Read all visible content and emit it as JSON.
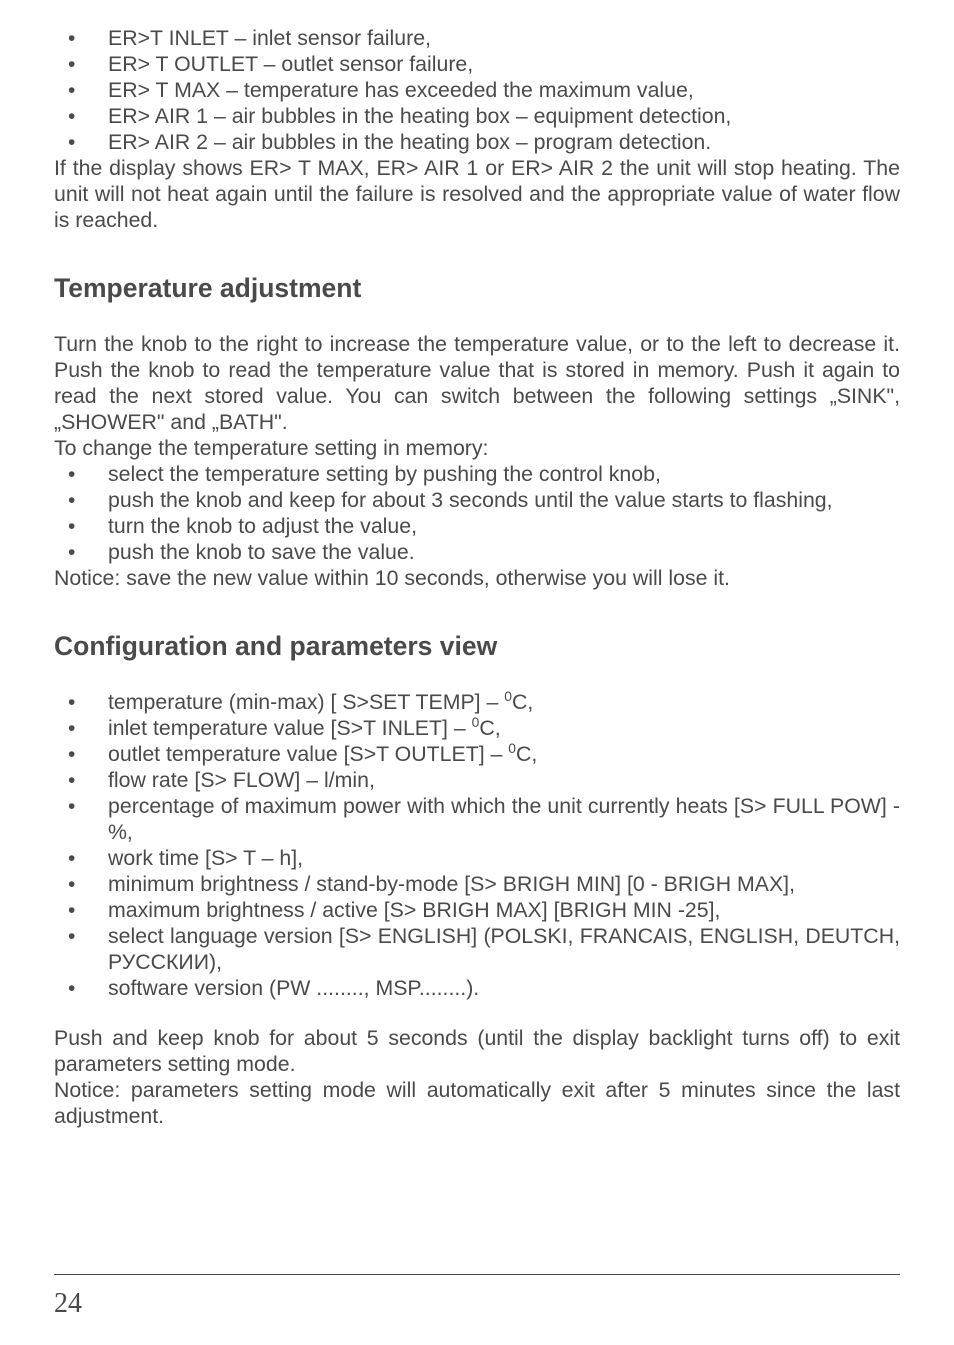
{
  "sec1": {
    "items": [
      "ER>T INLET – inlet sensor failure,",
      "ER> T OUTLET – outlet sensor failure,",
      "ER> T MAX – temperature has exceeded the maximum value,",
      "ER> AIR 1 – air bubbles in the heating box – equipment detection,",
      "ER> AIR 2 – air bubbles in the heating box – program detection."
    ],
    "para": "If the display shows ER> T MAX, ER> AIR 1 or ER> AIR 2 the unit will stop heating. The unit will not heat again until the failure is resolved and the appropriate value of water flow is reached."
  },
  "sec2": {
    "heading": "Temperature adjustment",
    "para1": "Turn the knob to the right to increase the temperature value, or to the left to decrease it. Push the knob to read the temperature value that is stored in memory. Push it again to read the next stored value. You can switch between the following settings „SINK\", „SHOWER\" and „BATH\".",
    "para2": "To change the temperature setting in memory:",
    "items": [
      "select the temperature setting by pushing the control knob,",
      "push the knob and keep for about 3 seconds until the value starts to flashing,",
      "turn the knob to adjust the value,",
      "push the knob to save the value."
    ],
    "para3": "Notice: save the new value within 10 seconds, otherwise you will lose it."
  },
  "sec3": {
    "heading": "Configuration and parameters view",
    "items": [
      {
        "pre": "temperature (min-max) [ S>SET TEMP] – ",
        "sup": "0",
        "post": "C,"
      },
      {
        "pre": "inlet temperature value [S>T INLET] – ",
        "sup": "0",
        "post": "C,"
      },
      {
        "pre": "outlet temperature value [S>T OUTLET] – ",
        "sup": "0",
        "post": "C,"
      },
      {
        "text": "flow rate [S> FLOW] – l/min,"
      },
      {
        "text": "percentage of maximum power with which the unit currently heats [S> FULL POW] -%,",
        "just": true
      },
      {
        "text": "work time [S> T – h],"
      },
      {
        "text": "minimum brightness / stand-by-mode [S> BRIGH MIN] [0 - BRIGH MAX],"
      },
      {
        "text": "maximum brightness / active [S> BRIGH MAX] [BRIGH MIN -25],"
      },
      {
        "text": "select language version [S> ENGLISH] (POLSKI, FRANCAIS, ENGLISH, DEUTCH, РУССКИИ),",
        "just": true
      },
      {
        "text": "software version (PW ........, MSP........)."
      }
    ],
    "para1": "Push and keep knob for about 5 seconds (until the display backlight turns off) to exit parameters setting mode.",
    "para2": "Notice: parameters setting mode will automatically exit after 5 minutes since the last adjustment."
  },
  "page": "24"
}
